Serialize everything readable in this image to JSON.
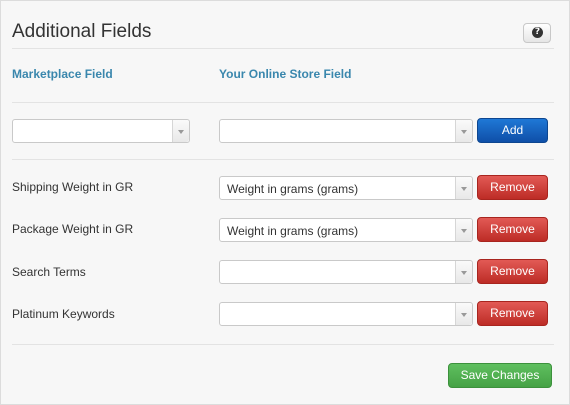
{
  "header": {
    "title": "Additional Fields",
    "help_icon": "question-mark-icon"
  },
  "columns": {
    "marketplace": "Marketplace Field",
    "store": "Your Online Store Field"
  },
  "add_row": {
    "marketplace_value": "",
    "store_value": "",
    "add_label": "Add"
  },
  "mapped_fields": [
    {
      "label": "Shipping Weight in GR",
      "value": "Weight in grams (grams)",
      "remove_label": "Remove"
    },
    {
      "label": "Package Weight in GR",
      "value": "Weight in grams (grams)",
      "remove_label": "Remove"
    },
    {
      "label": "Search Terms",
      "value": "",
      "remove_label": "Remove"
    },
    {
      "label": "Platinum Keywords",
      "value": "",
      "remove_label": "Remove"
    }
  ],
  "footer": {
    "save_label": "Save Changes"
  },
  "colors": {
    "add": "#1a64c0",
    "remove": "#d0403a",
    "save": "#52b052",
    "column_header": "#3a87ad"
  }
}
